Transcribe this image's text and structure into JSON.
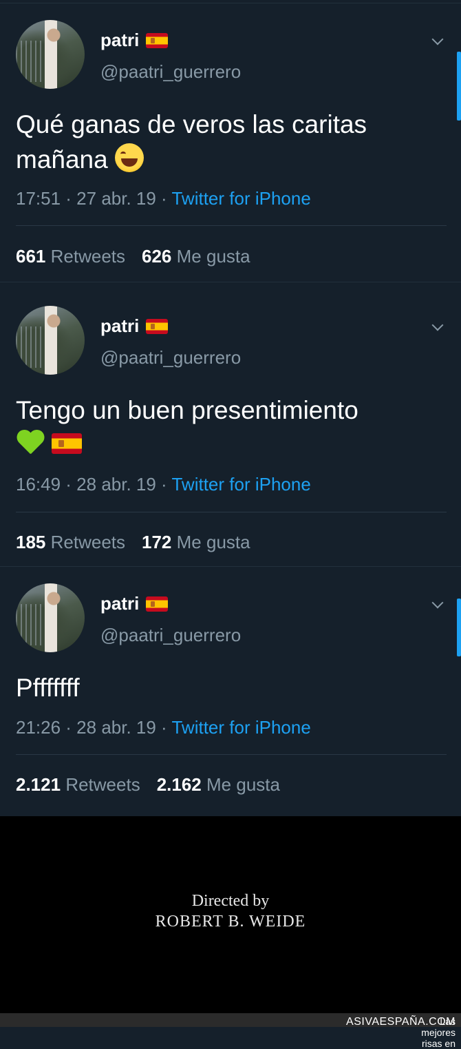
{
  "tweets": [
    {
      "name": "patri",
      "handle": "@paatri_guerrero",
      "text": "Qué ganas de veros las caritas mañana",
      "time": "17:51 · 27 abr. 19 · ",
      "source": "Twitter for iPhone",
      "retweets": "661",
      "retweets_label": "Retweets",
      "likes": "626",
      "likes_label": "Me gusta"
    },
    {
      "name": "patri",
      "handle": "@paatri_guerrero",
      "text": "Tengo un buen presentimiento",
      "time": "16:49 · 28 abr. 19 · ",
      "source": "Twitter for iPhone",
      "retweets": "185",
      "retweets_label": "Retweets",
      "likes": "172",
      "likes_label": "Me gusta"
    },
    {
      "name": "patri",
      "handle": "@paatri_guerrero",
      "text": "Pfffffff",
      "time": "21:26 · 28 abr. 19 · ",
      "source": "Twitter for iPhone",
      "retweets": "2.121",
      "retweets_label": "Retweets",
      "likes": "2.162",
      "likes_label": "Me gusta"
    }
  ],
  "credits": {
    "line1": "Directed by",
    "line2": "ROBERT B. WEIDE"
  },
  "footer": {
    "text": "Las mejores risas en ",
    "brand": "ASIVAESPAÑA.COM"
  },
  "colors": {
    "background": "#15202b",
    "accent": "#1da1f2",
    "muted": "#8899a6"
  }
}
